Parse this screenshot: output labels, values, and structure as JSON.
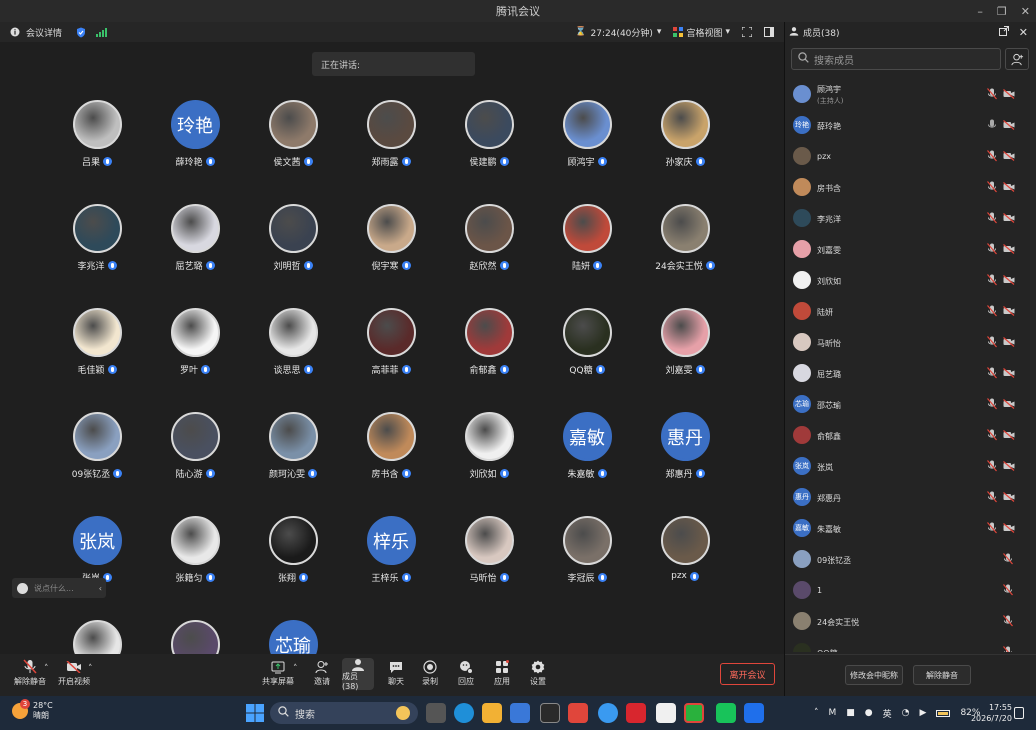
{
  "window": {
    "title": "腾讯会议"
  },
  "toolbar": {
    "meeting_details": "会议详情",
    "timer": "27:24(40分钟)",
    "grid_view": "宫格视图",
    "members_tab": "成员(38)"
  },
  "stage": {
    "speaking_label": "正在讲话:",
    "chat_placeholder": "说点什么...",
    "participants": [
      {
        "name": "吕果",
        "avatar": "photo",
        "color": "#bfbfbf"
      },
      {
        "name": "薛玲艳",
        "avatar": "text",
        "avatar_text": "玲艳"
      },
      {
        "name": "侯文茜",
        "avatar": "photo",
        "color": "#8e7a6a"
      },
      {
        "name": "郑雨露",
        "avatar": "photo",
        "color": "#5a4a40"
      },
      {
        "name": "侯建鹏",
        "avatar": "photo",
        "color": "#3b4a5e"
      },
      {
        "name": "顾鸿宇",
        "avatar": "photo",
        "color": "#6a8fd0"
      },
      {
        "name": "孙家庆",
        "avatar": "photo",
        "color": "#c9a36a"
      },
      {
        "name": "李兆洋",
        "avatar": "photo",
        "color": "#2e4a5a"
      },
      {
        "name": "屈艺璐",
        "avatar": "photo",
        "color": "#d8d8e0"
      },
      {
        "name": "刘明哲",
        "avatar": "photo",
        "color": "#3a4250"
      },
      {
        "name": "倪宇寒",
        "avatar": "photo",
        "color": "#c9a98a"
      },
      {
        "name": "赵欣然",
        "avatar": "photo",
        "color": "#6b5548"
      },
      {
        "name": "陆妍",
        "avatar": "photo",
        "color": "#c04a3a"
      },
      {
        "name": "24会实王悦",
        "avatar": "photo",
        "color": "#8a8070"
      },
      {
        "name": "毛佳颖",
        "avatar": "photo",
        "color": "#f2e6cf"
      },
      {
        "name": "罗叶",
        "avatar": "photo",
        "color": "#f5f5f5"
      },
      {
        "name": "谈思思",
        "avatar": "photo",
        "color": "#e6e6e6"
      },
      {
        "name": "高菲菲",
        "avatar": "photo",
        "color": "#5a2a2a"
      },
      {
        "name": "俞郁鑫",
        "avatar": "photo",
        "color": "#a03a3a"
      },
      {
        "name": "QQ糖",
        "avatar": "photo",
        "color": "#2a3020"
      },
      {
        "name": "刘嘉雯",
        "avatar": "photo",
        "color": "#e6a0a8"
      },
      {
        "name": "09张钇丞",
        "avatar": "photo",
        "color": "#8aa0c0"
      },
      {
        "name": "陆心游",
        "avatar": "photo",
        "color": "#4a5060"
      },
      {
        "name": "颜珂沁雯",
        "avatar": "photo",
        "color": "#7a90a8"
      },
      {
        "name": "房书含",
        "avatar": "photo",
        "color": "#c08a5a"
      },
      {
        "name": "刘欣如",
        "avatar": "photo",
        "color": "#f0f0f0"
      },
      {
        "name": "朱嘉敏",
        "avatar": "text",
        "avatar_text": "嘉敏"
      },
      {
        "name": "郑惠丹",
        "avatar": "text",
        "avatar_text": "惠丹"
      },
      {
        "name": "张岚",
        "avatar": "text",
        "avatar_text": "张岚"
      },
      {
        "name": "张籍匀",
        "avatar": "photo",
        "color": "#e8e8e8"
      },
      {
        "name": "张翔",
        "avatar": "photo",
        "color": "#1a1a1a"
      },
      {
        "name": "王梓乐",
        "avatar": "text",
        "avatar_text": "梓乐"
      },
      {
        "name": "马昕怡",
        "avatar": "photo",
        "color": "#d8c8c0"
      },
      {
        "name": "李冠辰",
        "avatar": "photo",
        "color": "#7a7068"
      },
      {
        "name": "pzx",
        "avatar": "photo",
        "color": "#6a5a4a"
      },
      {
        "name": "",
        "avatar": "photo",
        "color": "#e6e6e6"
      },
      {
        "name": "",
        "avatar": "photo",
        "color": "#5a4a6a"
      },
      {
        "name": "",
        "avatar": "text",
        "avatar_text": "芯瑜"
      }
    ]
  },
  "bottombar": {
    "unmute": "解除静音",
    "start_video": "开启视频",
    "share_screen": "共享屏幕",
    "invite": "邀请",
    "members": "成员(38)",
    "chat": "聊天",
    "record": "录制",
    "reactions": "回应",
    "apps": "应用",
    "settings": "设置",
    "leave": "离开会议"
  },
  "panel": {
    "search_placeholder": "搜索成员",
    "members": [
      {
        "name": "顾鸿宇",
        "sub": "(主持人)",
        "avatar": "photo",
        "color": "#6a8fd0",
        "mic_on": false,
        "cam": true
      },
      {
        "name": "薛玲艳",
        "sub": "",
        "avatar": "text",
        "avatar_text": "玲艳",
        "mic_on": true,
        "cam": true
      },
      {
        "name": "pzx",
        "sub": "",
        "avatar": "photo",
        "color": "#6a5a4a",
        "mic_on": false,
        "cam": true
      },
      {
        "name": "房书含",
        "sub": "",
        "avatar": "photo",
        "color": "#c08a5a",
        "mic_on": false,
        "cam": true
      },
      {
        "name": "李兆洋",
        "sub": "",
        "avatar": "photo",
        "color": "#2e4a5a",
        "mic_on": false,
        "cam": true
      },
      {
        "name": "刘嘉雯",
        "sub": "",
        "avatar": "photo",
        "color": "#e6a0a8",
        "mic_on": false,
        "cam": true
      },
      {
        "name": "刘欣如",
        "sub": "",
        "avatar": "photo",
        "color": "#f0f0f0",
        "mic_on": false,
        "cam": true
      },
      {
        "name": "陆妍",
        "sub": "",
        "avatar": "photo",
        "color": "#c04a3a",
        "mic_on": false,
        "cam": true
      },
      {
        "name": "马昕怡",
        "sub": "",
        "avatar": "photo",
        "color": "#d8c8c0",
        "mic_on": false,
        "cam": true
      },
      {
        "name": "屈艺璐",
        "sub": "",
        "avatar": "photo",
        "color": "#d8d8e0",
        "mic_on": false,
        "cam": true
      },
      {
        "name": "邵芯瑜",
        "sub": "",
        "avatar": "text",
        "avatar_text": "芯瑜",
        "mic_on": false,
        "cam": true
      },
      {
        "name": "俞郁鑫",
        "sub": "",
        "avatar": "photo",
        "color": "#a03a3a",
        "mic_on": false,
        "cam": true
      },
      {
        "name": "张岚",
        "sub": "",
        "avatar": "text",
        "avatar_text": "张岚",
        "mic_on": false,
        "cam": true
      },
      {
        "name": "郑惠丹",
        "sub": "",
        "avatar": "text",
        "avatar_text": "惠丹",
        "mic_on": false,
        "cam": true
      },
      {
        "name": "朱嘉敏",
        "sub": "",
        "avatar": "text",
        "avatar_text": "嘉敏",
        "mic_on": false,
        "cam": true
      },
      {
        "name": "09张钇丞",
        "sub": "",
        "avatar": "photo",
        "color": "#8aa0c0",
        "mic_on": false,
        "cam": false
      },
      {
        "name": "1",
        "sub": "",
        "avatar": "photo",
        "color": "#5a4a6a",
        "mic_on": false,
        "cam": false
      },
      {
        "name": "24会实王悦",
        "sub": "",
        "avatar": "photo",
        "color": "#8a8070",
        "mic_on": false,
        "cam": false
      },
      {
        "name": "QQ糖",
        "sub": "",
        "avatar": "photo",
        "color": "#2a3020",
        "mic_on": false,
        "cam": false
      }
    ],
    "rename_button": "修改会中昵称",
    "unmute_all_button": "解除静音"
  },
  "taskbar": {
    "weather_temp": "28°C",
    "weather_desc": "晴朗",
    "weather_badge": "3",
    "search_label": "搜索",
    "ime": "英",
    "battery": "82%",
    "time": "17:55",
    "date": "2026/7/20"
  },
  "colors": {
    "accent": "#3b6fc4",
    "leave": "#e0463b",
    "mute_red": "#e0463b"
  }
}
